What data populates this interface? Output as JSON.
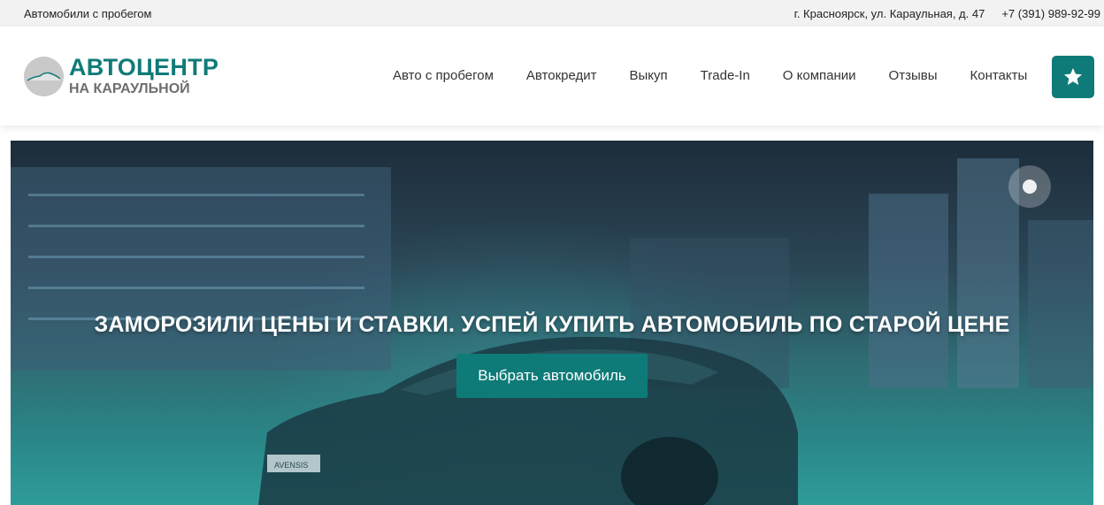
{
  "topbar": {
    "tagline": "Автомобили с пробегом",
    "address": "г. Красноярск, ул. Караульная, д. 47",
    "phone": "+7 (391) 989-92-99"
  },
  "header": {
    "logo_main": "АВТОЦЕНТР",
    "logo_sub": "НА КАРАУЛЬНОЙ",
    "nav": [
      "Авто с пробегом",
      "Автокредит",
      "Выкуп",
      "Trade-In",
      "О компании",
      "Отзывы",
      "Контакты"
    ],
    "favorites_icon": "star-icon"
  },
  "hero": {
    "title": "ЗАМОРОЗИЛИ ЦЕНЫ И СТАВКИ. УСПЕЙ КУПИТЬ АВТОМОБИЛЬ ПО СТАРОЙ ЦЕНЕ",
    "button_label": "Выбрать автомобиль",
    "background_image": "night-city-car-photo",
    "plate_text": "AVENSIS"
  },
  "colors": {
    "brand": "#0f7b78",
    "topbar_bg": "#f2f2f2",
    "logo_sub": "#6e6e6e"
  }
}
